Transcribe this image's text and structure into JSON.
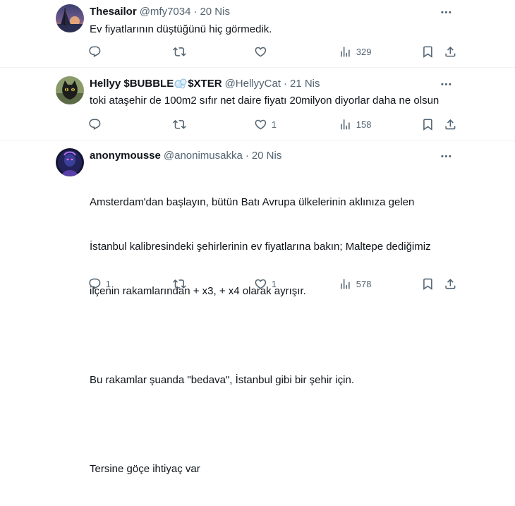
{
  "tweets": [
    {
      "name": "Thesailor",
      "handle": "@mfy7034",
      "dot": "·",
      "time": "20 Nis",
      "text": "Ev fiyatlarının düştüğünü hiç görmedik.",
      "replies": "",
      "retweets": "",
      "likes": "",
      "views": "329"
    },
    {
      "name_prefix": "Hellyy $BUBBLE",
      "name_suffix": "$XTER",
      "handle": "@HellyyCat",
      "dot": "·",
      "time": "21 Nis",
      "text": "toki ataşehir de 100m2 sıfır net daire fiyatı 20milyon diyorlar daha ne olsun",
      "replies": "",
      "retweets": "",
      "likes": "1",
      "views": "158"
    },
    {
      "name": "anonymousse",
      "handle": "@anonimusakka",
      "dot": "·",
      "time": "20 Nis",
      "text_lines": [
        "Amsterdam'dan başlayın, bütün Batı Avrupa ülkelerinin aklınıza gelen",
        "İstanbul kalibresindeki şehirlerinin ev fiyatlarına bakın; Maltepe dediğimiz",
        "ilçenin rakamlarından + x3, + x4 olarak ayrışır.",
        "",
        "Bu rakamlar şuanda \"bedava\", İstanbul gibi bir şehir için.",
        "",
        "Tersine göçe ihtiyaç var"
      ],
      "replies": "1",
      "retweets": "",
      "likes": "1",
      "views": "578"
    }
  ],
  "icons": {
    "more": "more-horizontal-icon",
    "reply": "reply-icon",
    "retweet": "retweet-icon",
    "like": "heart-icon",
    "views": "views-bar-chart-icon",
    "bookmark": "bookmark-icon",
    "share": "share-upload-icon",
    "name_emoji": "bubble-emoji-icon"
  },
  "colors": {
    "text": "#0f1419",
    "secondary": "#536471",
    "divider": "#eff3f4"
  }
}
